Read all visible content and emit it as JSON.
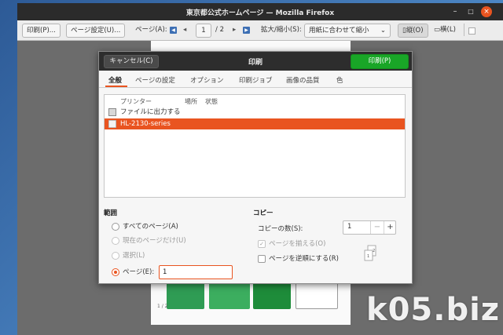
{
  "window": {
    "title": "東京都公式ホームページ — Mozilla Firefox"
  },
  "toolbar": {
    "print_label": "印刷(P)...",
    "page_setup_label": "ページ設定(U)...",
    "page_label": "ページ(A):",
    "page_current": "1",
    "page_total": "/ 2",
    "zoom_label": "拡大/縮小(S):",
    "zoom_value": "用紙に合わせて縮小",
    "portrait_label": "縦(O)",
    "landscape_label": "横(L)"
  },
  "dialog": {
    "title": "印刷",
    "cancel_label": "キャンセル(C)",
    "print_label": "印刷(P)",
    "tabs": [
      "全般",
      "ページの設定",
      "オプション",
      "印刷ジョブ",
      "画像の品質",
      "色"
    ],
    "printer_columns": [
      "プリンター",
      "場所",
      "状態"
    ],
    "printers": [
      {
        "name": "ファイルに出力する",
        "icon": "file-icon",
        "selected": false
      },
      {
        "name": "HL-2130-series",
        "icon": "printer-icon",
        "selected": true
      }
    ],
    "range": {
      "title": "範囲",
      "all_pages": "すべてのページ(A)",
      "current_page": "現在のページだけ(U)",
      "selection": "選択(L)",
      "pages": "ページ(E):",
      "pages_value": "1"
    },
    "copies": {
      "title": "コピー",
      "count_label": "コピーの数(S):",
      "count_value": "1",
      "collate_label": "ページを揃える(O)",
      "reverse_label": "ページを逆順にする(R)"
    }
  },
  "preview": {
    "page_num": "1 / 2"
  },
  "watermark": {
    "text": "k05.biz"
  },
  "colors": {
    "accent": "#e95420",
    "print_button": "#19a627",
    "titlebar": "#2b2b2b"
  }
}
